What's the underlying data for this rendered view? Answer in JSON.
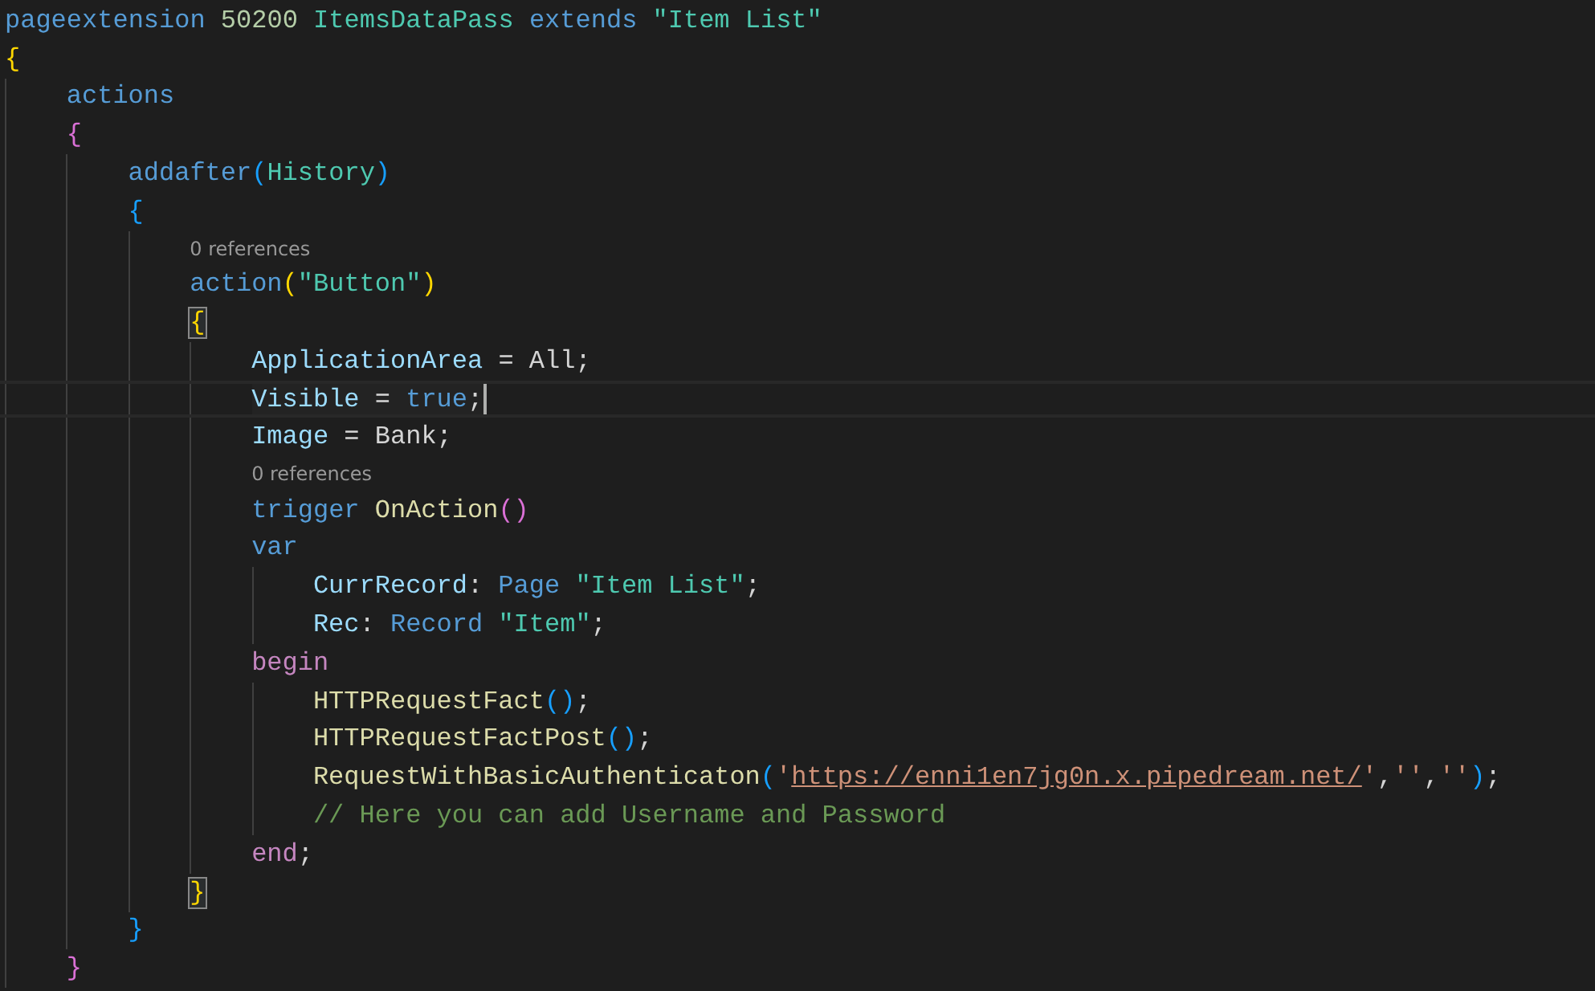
{
  "lines": [
    {
      "kind": "code",
      "current": false,
      "tokens": [
        {
          "text": "pageextension ",
          "kind": "kw"
        },
        {
          "text": "50200 ",
          "kind": "num"
        },
        {
          "text": "ItemsDataPass ",
          "kind": "type"
        },
        {
          "text": "extends ",
          "kind": "kw"
        },
        {
          "text": "\"Item List\"",
          "kind": "type"
        }
      ]
    },
    {
      "kind": "code",
      "current": false,
      "bracket_match": false,
      "tokens": [
        {
          "text": "{",
          "kind": "b1"
        }
      ],
      "children": [
        {
          "kind": "code",
          "current": false,
          "tokens": [
            {
              "text": "actions",
              "kind": "kw"
            }
          ]
        },
        {
          "kind": "code",
          "current": false,
          "bracket_match": false,
          "tokens": [
            {
              "text": "{",
              "kind": "b2"
            }
          ],
          "children": [
            {
              "kind": "code",
              "current": false,
              "tokens": [
                {
                  "text": "addafter",
                  "kind": "kw"
                },
                {
                  "text": "(",
                  "kind": "b3"
                },
                {
                  "text": "History",
                  "kind": "type"
                },
                {
                  "text": ")",
                  "kind": "b3"
                }
              ]
            },
            {
              "kind": "code",
              "current": false,
              "bracket_match": false,
              "tokens": [
                {
                  "text": "{",
                  "kind": "b3"
                }
              ],
              "children": [
                {
                  "kind": "codelens",
                  "text": "0 references"
                },
                {
                  "kind": "code",
                  "current": false,
                  "tokens": [
                    {
                      "text": "action",
                      "kind": "kw"
                    },
                    {
                      "text": "(",
                      "kind": "b1"
                    },
                    {
                      "text": "\"Button\"",
                      "kind": "type"
                    },
                    {
                      "text": ")",
                      "kind": "b1"
                    }
                  ]
                },
                {
                  "kind": "code",
                  "current": false,
                  "bracket_match": true,
                  "tokens": [
                    {
                      "text": "{",
                      "kind": "b1"
                    }
                  ],
                  "children": [
                    {
                      "kind": "code",
                      "current": false,
                      "tokens": [
                        {
                          "text": "ApplicationArea",
                          "kind": "prop"
                        },
                        {
                          "text": " = All;",
                          "kind": "plain"
                        }
                      ]
                    },
                    {
                      "kind": "code",
                      "current": true,
                      "tokens": [
                        {
                          "text": "Visible",
                          "kind": "prop"
                        },
                        {
                          "text": " = ",
                          "kind": "plain"
                        },
                        {
                          "text": "true",
                          "kind": "kw"
                        },
                        {
                          "text": ";",
                          "kind": "plain"
                        }
                      ]
                    },
                    {
                      "kind": "code",
                      "current": false,
                      "tokens": [
                        {
                          "text": "Image",
                          "kind": "prop"
                        },
                        {
                          "text": " = Bank;",
                          "kind": "plain"
                        }
                      ]
                    },
                    {
                      "kind": "codelens",
                      "text": "0 references"
                    },
                    {
                      "kind": "code",
                      "current": false,
                      "tokens": [
                        {
                          "text": "trigger ",
                          "kind": "kw"
                        },
                        {
                          "text": "OnAction",
                          "kind": "fn"
                        },
                        {
                          "text": "()",
                          "kind": "b2"
                        }
                      ]
                    },
                    {
                      "kind": "code",
                      "current": false,
                      "tokens": [
                        {
                          "text": "var",
                          "kind": "kw"
                        }
                      ],
                      "children": [
                        {
                          "kind": "code",
                          "current": false,
                          "tokens": [
                            {
                              "text": "CurrRecord",
                              "kind": "prop"
                            },
                            {
                              "text": ": ",
                              "kind": "plain"
                            },
                            {
                              "text": "Page ",
                              "kind": "kw"
                            },
                            {
                              "text": "\"Item List\"",
                              "kind": "type"
                            },
                            {
                              "text": ";",
                              "kind": "plain"
                            }
                          ]
                        },
                        {
                          "kind": "code",
                          "current": false,
                          "tokens": [
                            {
                              "text": "Rec",
                              "kind": "prop"
                            },
                            {
                              "text": ": ",
                              "kind": "plain"
                            },
                            {
                              "text": "Record ",
                              "kind": "kw"
                            },
                            {
                              "text": "\"Item\"",
                              "kind": "type"
                            },
                            {
                              "text": ";",
                              "kind": "plain"
                            }
                          ]
                        }
                      ]
                    },
                    {
                      "kind": "code",
                      "current": false,
                      "tokens": [
                        {
                          "text": "begin",
                          "kind": "ctrl"
                        }
                      ],
                      "children": [
                        {
                          "kind": "code",
                          "current": false,
                          "tokens": [
                            {
                              "text": "HTTPRequestFact",
                              "kind": "fn"
                            },
                            {
                              "text": "()",
                              "kind": "b3"
                            },
                            {
                              "text": ";",
                              "kind": "plain"
                            }
                          ]
                        },
                        {
                          "kind": "code",
                          "current": false,
                          "tokens": [
                            {
                              "text": "HTTPRequestFactPost",
                              "kind": "fn"
                            },
                            {
                              "text": "()",
                              "kind": "b3"
                            },
                            {
                              "text": ";",
                              "kind": "plain"
                            }
                          ]
                        },
                        {
                          "kind": "code",
                          "current": false,
                          "tokens": [
                            {
                              "text": "RequestWithBasicAuthenticaton",
                              "kind": "fn"
                            },
                            {
                              "text": "(",
                              "kind": "b3"
                            },
                            {
                              "text": "'",
                              "kind": "str"
                            },
                            {
                              "text": "https://enni1en7jg0n.x.pipedream.net/",
                              "kind": "url"
                            },
                            {
                              "text": "'",
                              "kind": "str"
                            },
                            {
                              "text": ",",
                              "kind": "plain"
                            },
                            {
                              "text": "''",
                              "kind": "str"
                            },
                            {
                              "text": ",",
                              "kind": "plain"
                            },
                            {
                              "text": "''",
                              "kind": "str"
                            },
                            {
                              "text": ")",
                              "kind": "b3"
                            },
                            {
                              "text": ";",
                              "kind": "plain"
                            }
                          ]
                        },
                        {
                          "kind": "code",
                          "current": false,
                          "tokens": [
                            {
                              "text": "// Here you can add Username and Password",
                              "kind": "comment"
                            }
                          ]
                        }
                      ]
                    },
                    {
                      "kind": "code",
                      "current": false,
                      "tokens": [
                        {
                          "text": "end",
                          "kind": "ctrl"
                        },
                        {
                          "text": ";",
                          "kind": "plain"
                        }
                      ]
                    }
                  ]
                },
                {
                  "kind": "code",
                  "current": false,
                  "bracket_match": true,
                  "tokens": [
                    {
                      "text": "}",
                      "kind": "b1"
                    }
                  ]
                }
              ]
            },
            {
              "kind": "code",
              "current": false,
              "bracket_match": false,
              "tokens": [
                {
                  "text": "}",
                  "kind": "b3"
                }
              ]
            }
          ]
        },
        {
          "kind": "code",
          "current": false,
          "bracket_match": false,
          "tokens": [
            {
              "text": "}",
              "kind": "b2"
            }
          ]
        }
      ]
    }
  ]
}
